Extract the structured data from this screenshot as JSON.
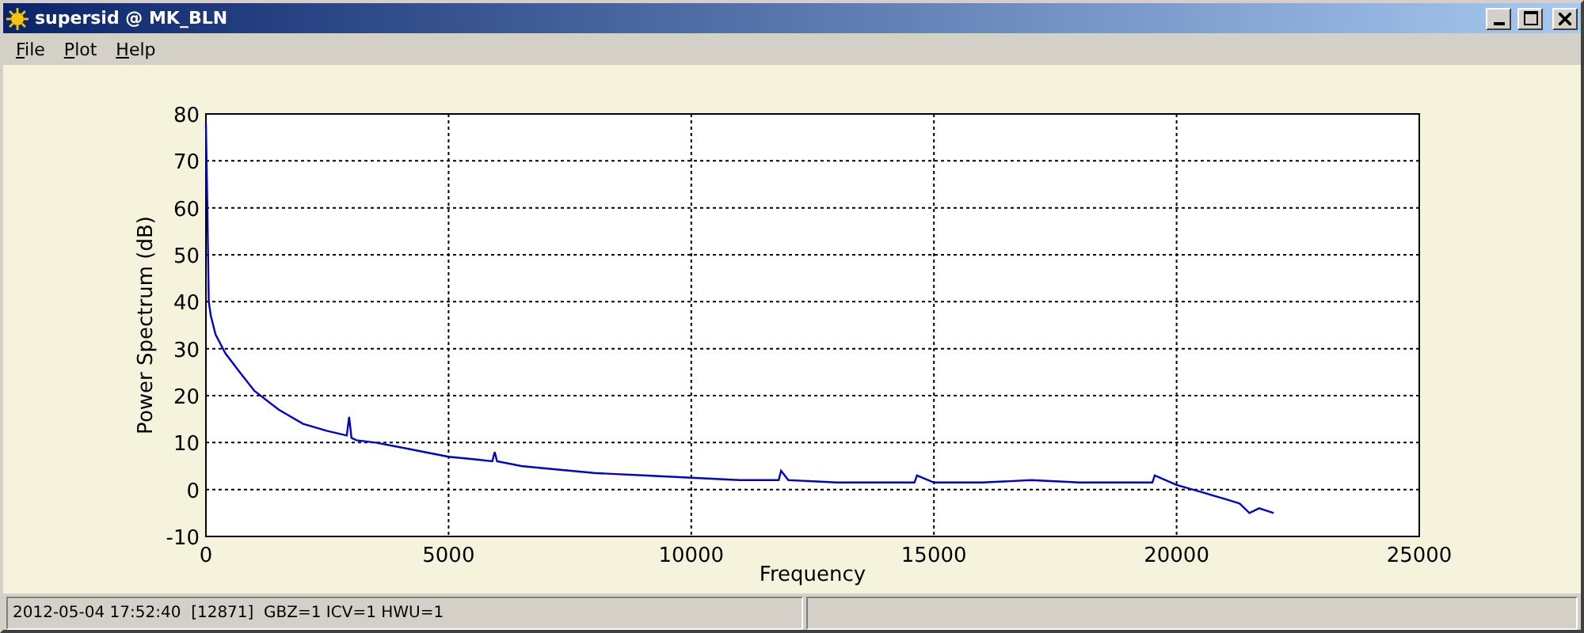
{
  "window": {
    "title": "supersid @ MK_BLN"
  },
  "menu": [
    {
      "label": "File"
    },
    {
      "label": "Plot"
    },
    {
      "label": "Help"
    }
  ],
  "plot": {
    "chart_data": {
      "type": "line",
      "grid": true,
      "xlabel": "Frequency",
      "ylabel": "Power Spectrum (dB)",
      "xlim": [
        0,
        25000
      ],
      "ylim": [
        -10,
        80
      ],
      "xticks": [
        0,
        5000,
        10000,
        15000,
        20000,
        25000
      ],
      "yticks": [
        -10,
        0,
        10,
        20,
        30,
        40,
        50,
        60,
        70,
        80
      ],
      "x": [
        0,
        30,
        60,
        100,
        200,
        400,
        700,
        1000,
        1500,
        2000,
        2500,
        2900,
        2950,
        3000,
        3100,
        3500,
        4000,
        4500,
        5000,
        5500,
        5900,
        5950,
        6000,
        6500,
        7000,
        8000,
        9000,
        10000,
        11000,
        11800,
        11850,
        12000,
        13000,
        14000,
        14600,
        14650,
        15000,
        16000,
        17000,
        18000,
        19000,
        19500,
        19550,
        20000,
        20500,
        21000,
        21300,
        21500,
        21700,
        22000
      ],
      "series": [
        {
          "color": "#0000cc",
          "values": [
            78,
            60,
            40,
            37,
            33,
            29,
            25,
            21,
            17,
            14,
            12.5,
            11.5,
            15.5,
            11,
            10.5,
            10,
            9,
            8,
            7,
            6.5,
            6,
            8,
            6,
            5,
            4.5,
            3.5,
            3,
            2.5,
            2,
            2,
            4,
            2,
            1.5,
            1.5,
            1.5,
            3,
            1.5,
            1.5,
            2,
            1.5,
            1.5,
            1.5,
            3,
            1,
            -0.5,
            -2,
            -3,
            -5,
            -4,
            -5
          ]
        }
      ]
    }
  },
  "status_bar": {
    "text": "2012-05-04 17:52:40  [12871]  GBZ=1 ICV=1 HWU=1"
  }
}
